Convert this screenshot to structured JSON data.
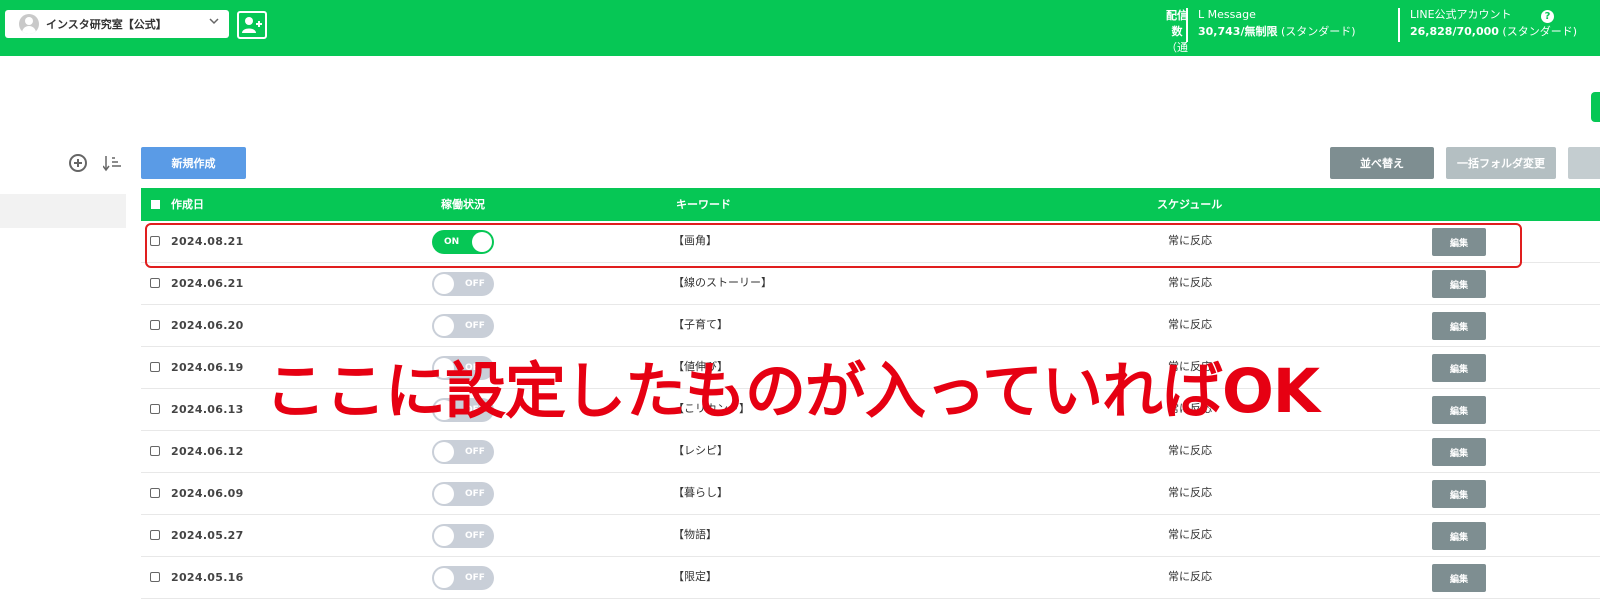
{
  "header": {
    "account_name": "インスタ研究室【公式】",
    "delivery_label_line1": "配信数",
    "delivery_label_line2": "（通数）",
    "lmessage_label": "L Message",
    "lmessage_count": "30,743/無制限",
    "lmessage_plan": "(スタンダード)",
    "line_account_label": "LINE公式アカウント",
    "line_account_count": "26,828/70,000",
    "line_account_plan": "(スタンダード)",
    "help_icon_glyph": "?"
  },
  "toolbar": {
    "new_label": "新規作成",
    "sort_label": "並べ替え",
    "bulk_folder_label": "一括フォルダ変更"
  },
  "table": {
    "headers": {
      "created": "作成日",
      "status": "稼働状況",
      "keyword": "キーワード",
      "schedule": "スケジュール"
    },
    "edit_label": "編集",
    "rows": [
      {
        "date": "2024.08.21",
        "status": "ON",
        "keyword": "【画角】",
        "schedule": "常に反応"
      },
      {
        "date": "2024.06.21",
        "status": "OFF",
        "keyword": "【線のストーリー】",
        "schedule": "常に反応"
      },
      {
        "date": "2024.06.20",
        "status": "OFF",
        "keyword": "【子育て】",
        "schedule": "常に反応"
      },
      {
        "date": "2024.06.19",
        "status": "OFF",
        "keyword": "【値伸び】",
        "schedule": "常に反応"
      },
      {
        "date": "2024.06.13",
        "status": "OFF",
        "keyword": "【こリカンド】",
        "schedule": "常に反応"
      },
      {
        "date": "2024.06.12",
        "status": "OFF",
        "keyword": "【レシピ】",
        "schedule": "常に反応"
      },
      {
        "date": "2024.06.09",
        "status": "OFF",
        "keyword": "【暮らし】",
        "schedule": "常に反応"
      },
      {
        "date": "2024.05.27",
        "status": "OFF",
        "keyword": "【物語】",
        "schedule": "常に反応"
      },
      {
        "date": "2024.05.16",
        "status": "OFF",
        "keyword": "【限定】",
        "schedule": "常に反応"
      }
    ]
  },
  "annotation": {
    "text": "ここに設定したものが入っていればOK",
    "color": "#e60012"
  },
  "colors": {
    "brand_green": "#06c755",
    "new_button_blue": "#5a9be6",
    "gray_button": "#7e8e91",
    "toggle_off": "#c9cfd8",
    "highlight_red": "#e01e1e"
  }
}
